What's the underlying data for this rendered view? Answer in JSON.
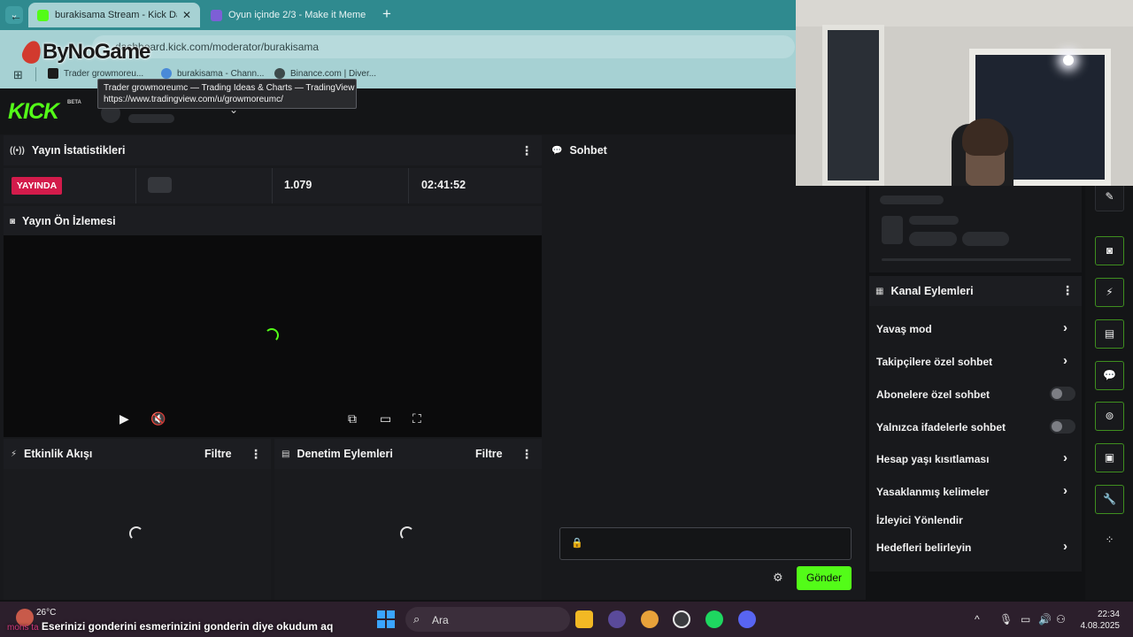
{
  "browser": {
    "tabs": [
      {
        "title": "burakisama Stream - Kick Dashboard",
        "active": true
      },
      {
        "title": "Oyun içinde 2/3 - Make it Meme",
        "active": false
      }
    ],
    "watermark": "ByNoGame",
    "url": "dashboard.kick.com/moderator/burakisama",
    "bookmarks": [
      {
        "label": "Trader growmoreu..."
      },
      {
        "label": "burakisama - Chann..."
      },
      {
        "label": "Binance.com | Diver..."
      }
    ],
    "tooltip": {
      "title": "Trader growmoreumc — Trading Ideas & Charts — TradingView",
      "url": "https://www.tradingview.com/u/growmoreumc/"
    }
  },
  "kick": {
    "logo": "KICK",
    "beta": "BETA",
    "stats_panel": {
      "title": "Yayın İstatistikleri",
      "live_badge": "YAYINDA",
      "viewers": "1.079",
      "duration": "02:41:52"
    },
    "preview_panel": {
      "title": "Yayın Ön İzlemesi"
    },
    "activity_panel": {
      "title": "Etkinlik Akışı",
      "filter": "Filtre"
    },
    "moderation_panel": {
      "title": "Denetim Eylemleri",
      "filter": "Filtre"
    },
    "chat_panel": {
      "title": "Sohbet",
      "send_label": "Gönder"
    },
    "channel_actions": {
      "title": "Kanal Eylemleri",
      "items": [
        {
          "label": "Yavaş mod"
        },
        {
          "label": "Takipçilere özel sohbet"
        },
        {
          "label": "Abonelere özel sohbet"
        },
        {
          "label": "Yalnızca ifadelerle sohbet"
        },
        {
          "label": "Hesap yaşı kısıtlaması"
        },
        {
          "label": "Yasaklanmış kelimeler"
        },
        {
          "label": "İzleyici Yönlendir"
        },
        {
          "label": "Hedefleri belirleyin"
        }
      ]
    }
  },
  "taskbar": {
    "temperature": "26°C",
    "ticker_prefix": "mons ta",
    "ticker_text": "Eserinizi gonderini esmerinizini gonderin diye okudum aq",
    "search_placeholder": "Ara",
    "time": "22:34",
    "date": "4.08.2025"
  },
  "colors": {
    "kick_green": "#53fc18",
    "live_red": "#d31b4b",
    "tab_teal": "#2f8a8f",
    "toolbar_teal": "#a6d1d3"
  }
}
